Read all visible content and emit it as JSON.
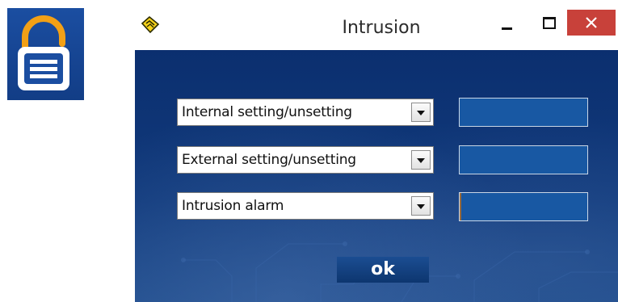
{
  "window": {
    "title": "Intrusion"
  },
  "lock_tile": {
    "icon": "unlocked-padlock-icon",
    "background": "#1b4ea1",
    "accent": "#f2a016"
  },
  "rows": [
    {
      "selected": "Internal setting/unsetting"
    },
    {
      "selected": "External setting/unsetting"
    },
    {
      "selected": "Intrusion alarm"
    }
  ],
  "ok_label": "ok",
  "colors": {
    "client_background": "#0b2f6f",
    "status_box": "#1858a3",
    "close_button": "#c8413a"
  }
}
